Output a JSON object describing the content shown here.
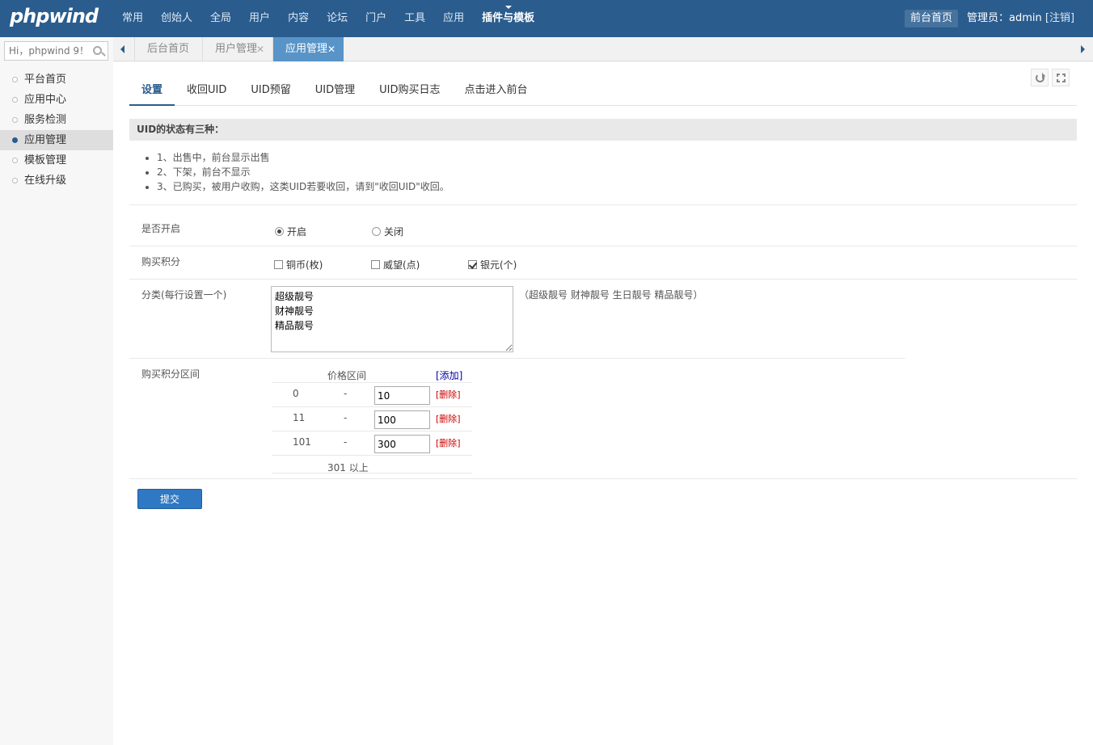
{
  "header": {
    "logo": "phpwind",
    "nav": [
      "常用",
      "创始人",
      "全局",
      "用户",
      "内容",
      "论坛",
      "门户",
      "工具",
      "应用",
      "插件与模板"
    ],
    "active_nav": 9,
    "frontpage": "前台首页",
    "admin_prefix": "管理员：admin",
    "logout": "[注销]"
  },
  "sidebar": {
    "search_placeholder": "Hi，phpwind 9！",
    "items": [
      {
        "label": "平台首页"
      },
      {
        "label": "应用中心"
      },
      {
        "label": "服务检测"
      },
      {
        "label": "应用管理",
        "active": true
      },
      {
        "label": "模板管理"
      },
      {
        "label": "在线升级"
      }
    ]
  },
  "tabs": {
    "items": [
      {
        "label": "后台首页"
      },
      {
        "label": "用户管理",
        "close": "✕"
      },
      {
        "label": "应用管理",
        "close": "✕",
        "active": true
      }
    ]
  },
  "subtabs": [
    "设置",
    "收回UID",
    "UID预留",
    "UID管理",
    "UID购买日志",
    "点击进入前台"
  ],
  "info": {
    "title": "UID的状态有三种：",
    "items": [
      "1、出售中，前台显示出售",
      "2、下架，前台不显示",
      "3、已购买，被用户收购，这类UID若要收回，请到\"收回UID\"收回。"
    ]
  },
  "form": {
    "enable": {
      "label": "是否开启",
      "on": "开启",
      "off": "关闭",
      "value": "开启"
    },
    "credit": {
      "label": "购买积分",
      "options": [
        {
          "label": "铜币(枚)",
          "checked": false
        },
        {
          "label": "威望(点)",
          "checked": false
        },
        {
          "label": "银元(个)",
          "checked": true
        }
      ]
    },
    "category": {
      "label": "分类(每行设置一个)",
      "value": "超级靓号\n财神靓号\n精品靓号",
      "hint": "（超级靓号 财神靓号 生日靓号 精品靓号）"
    },
    "range": {
      "label": "购买积分区间",
      "header": "价格区间",
      "add": "[添加]",
      "delete": "[删除]",
      "dash": "-",
      "rows": [
        {
          "from": "0",
          "to": "10"
        },
        {
          "from": "11",
          "to": "100"
        },
        {
          "from": "101",
          "to": "300"
        }
      ],
      "footer": "301 以上"
    },
    "submit": "提交"
  }
}
